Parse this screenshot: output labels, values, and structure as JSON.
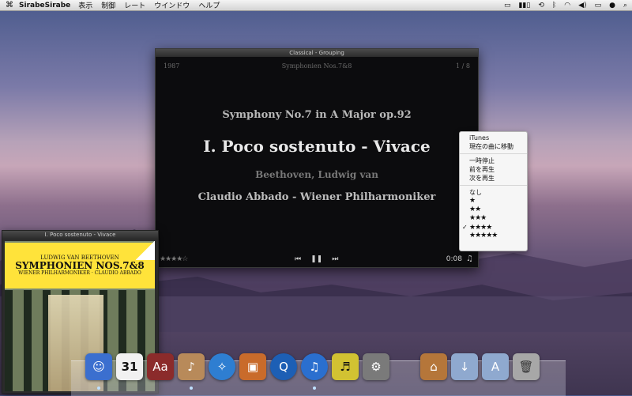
{
  "menubar": {
    "app_name": "SirabeSirabe",
    "menus": [
      "表示",
      "制御",
      "レート",
      "ウインドウ",
      "ヘルプ"
    ]
  },
  "player": {
    "window_title": "Classical - Grouping",
    "year": "1987",
    "album": "Symphonien Nos.7&8",
    "track_number": "1 / 8",
    "work": "Symphony No.7 in A Major op.92",
    "movement": "I. Poco sostenuto - Vivace",
    "composer": "Beethoven, Ludwig van",
    "performer": "Claudio Abbado - Wiener Philharmoniker",
    "rating_display": "★★★★☆",
    "controls": {
      "prev": "⏮",
      "pause": "❚❚",
      "next": "⏭"
    },
    "time": "0:08",
    "note_icon": "♫"
  },
  "context_menu": {
    "items": [
      "iTunes",
      "現在の曲に移動",
      "一時停止",
      "前を再生",
      "次を再生",
      "なし",
      "★",
      "★★",
      "★★★",
      "★★★★",
      "★★★★★"
    ],
    "checked_item": "★★★★",
    "check_mark": "✓"
  },
  "art_panel": {
    "title": "I. Poco sostenuto - Vivace",
    "cover": {
      "line1": "LUDWIG VAN BEETHOVEN",
      "line2": "SYMPHONIEN NOS.7&8",
      "line3": "WIENER PHILHARMONIKER · CLAUDIO ABBADO"
    }
  },
  "dock": {
    "icons": [
      {
        "name": "finder-icon",
        "color": "#3b6fcf"
      },
      {
        "name": "calendar-icon",
        "color": "#e9e9e9",
        "label": "31"
      },
      {
        "name": "dictionary-icon",
        "color": "#8b2b2b",
        "label": "Aa"
      },
      {
        "name": "sirabe-app-icon",
        "color": "#b88a5a"
      },
      {
        "name": "safari-icon",
        "color": "#2e7ed1"
      },
      {
        "name": "photos-icon",
        "color": "#c96b2b"
      },
      {
        "name": "quicktime-icon",
        "color": "#1d5fb5"
      },
      {
        "name": "itunes-icon",
        "color": "#2a6fcf"
      },
      {
        "name": "album-icon",
        "color": "#d2c232"
      },
      {
        "name": "system-preferences-icon",
        "color": "#7a7a7a"
      },
      {
        "name": "home-folder-icon",
        "color": "#b5763a"
      },
      {
        "name": "downloads-folder-icon",
        "color": "#8fa9cf"
      },
      {
        "name": "applications-folder-icon",
        "color": "#8fa9cf"
      },
      {
        "name": "trash-icon",
        "color": "#a7a7a7"
      }
    ]
  }
}
